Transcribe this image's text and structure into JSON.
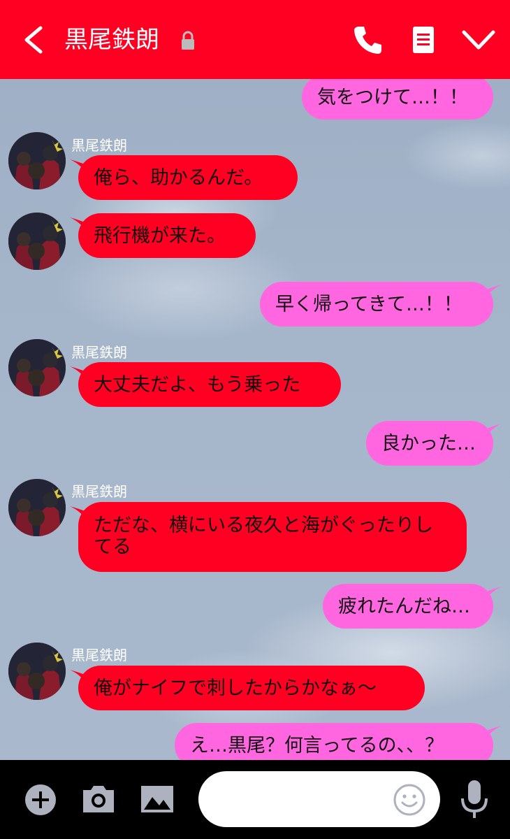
{
  "header": {
    "title": "黒尾鉄朗",
    "background": "#ff0022"
  },
  "messages": [
    {
      "side": "right",
      "text": "気をつけて…！！"
    },
    {
      "side": "left",
      "sender": "黒尾鉄朗",
      "text": "俺ら、助かるんだ。"
    },
    {
      "side": "left",
      "text": "飛行機が来た。"
    },
    {
      "side": "right",
      "text": "早く帰ってきて…！！"
    },
    {
      "side": "left",
      "sender": "黒尾鉄朗",
      "text": "大丈夫だよ、もう乗った"
    },
    {
      "side": "right",
      "text": "良かった…"
    },
    {
      "side": "left",
      "sender": "黒尾鉄朗",
      "text": "ただな、横にいる夜久と海がぐったりしてる"
    },
    {
      "side": "right",
      "text": "疲れたんだね…"
    },
    {
      "side": "left",
      "sender": "黒尾鉄朗",
      "text": "俺がナイフで刺したからかなぁ～"
    },
    {
      "side": "right",
      "text": "え…黒尾？何言ってるの、、？"
    }
  ],
  "input": {
    "value": "",
    "placeholder": ""
  },
  "colors": {
    "left_bubble": "#ff0022",
    "right_bubble": "#ff66e0"
  },
  "icons": [
    "back-icon",
    "lock-icon",
    "phone-icon",
    "notes-icon",
    "chevron-down-icon",
    "plus-icon",
    "camera-icon",
    "image-icon",
    "emoji-icon",
    "mic-icon"
  ]
}
